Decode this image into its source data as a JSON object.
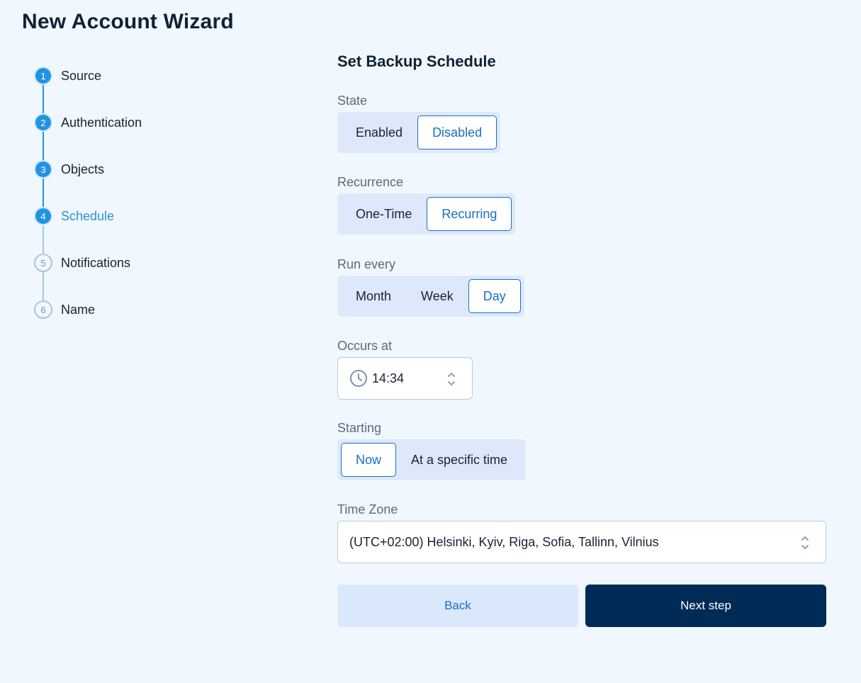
{
  "wizard": {
    "title": "New Account Wizard"
  },
  "steps": [
    {
      "number": "1",
      "label": "Source",
      "status": "done"
    },
    {
      "number": "2",
      "label": "Authentication",
      "status": "done"
    },
    {
      "number": "3",
      "label": "Objects",
      "status": "done"
    },
    {
      "number": "4",
      "label": "Schedule",
      "status": "active"
    },
    {
      "number": "5",
      "label": "Notifications",
      "status": "todo"
    },
    {
      "number": "6",
      "label": "Name",
      "status": "todo"
    }
  ],
  "form": {
    "title": "Set Backup Schedule",
    "state": {
      "label": "State",
      "options": [
        "Enabled",
        "Disabled"
      ],
      "selected": "Disabled"
    },
    "recurrence": {
      "label": "Recurrence",
      "options": [
        "One-Time",
        "Recurring"
      ],
      "selected": "Recurring"
    },
    "run_every": {
      "label": "Run every",
      "options": [
        "Month",
        "Week",
        "Day"
      ],
      "selected": "Day"
    },
    "occurs_at": {
      "label": "Occurs at",
      "value": "14:34",
      "icon": "clock-icon"
    },
    "starting": {
      "label": "Starting",
      "options": [
        "Now",
        "At a specific time"
      ],
      "selected": "Now"
    },
    "time_zone": {
      "label": "Time Zone",
      "value": "(UTC+02:00) Helsinki, Kyiv, Riga, Sofia, Tallinn, Vilnius"
    }
  },
  "buttons": {
    "back": "Back",
    "next": "Next step"
  },
  "colors": {
    "accent": "#2293e3",
    "primary_button": "#002b57",
    "selected_text": "#1a6fc0",
    "background": "#f0f7ff"
  }
}
